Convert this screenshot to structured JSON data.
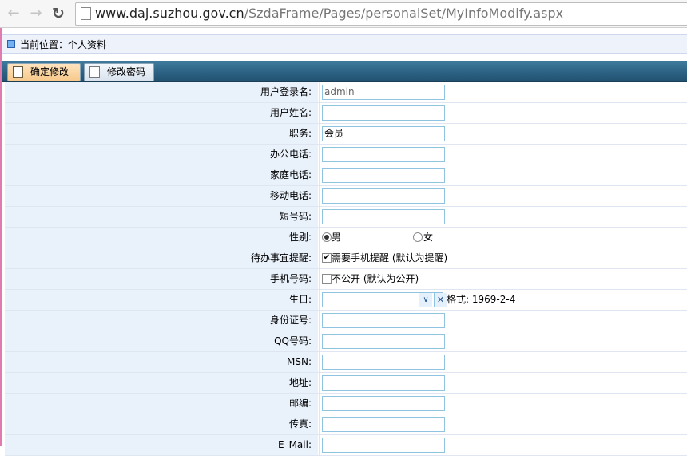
{
  "browser": {
    "url_host": "www.daj.suzhou.gov.cn",
    "url_path": "/SzdaFrame/Pages/personalSet/MyInfoModify.aspx"
  },
  "breadcrumb": "当前位置：个人资料",
  "toolbar": {
    "save_label": "确定修改",
    "password_label": "修改密码"
  },
  "fields": [
    {
      "label": "用户登录名:",
      "value": "admin"
    },
    {
      "label": "用户姓名:",
      "value": ""
    },
    {
      "label": "职务:",
      "value": "会员"
    },
    {
      "label": "办公电话:",
      "value": ""
    },
    {
      "label": "家庭电话:",
      "value": ""
    },
    {
      "label": "移动电话:",
      "value": ""
    },
    {
      "label": "短号码:",
      "value": ""
    }
  ],
  "gender": {
    "label": "性别:",
    "male": "男",
    "female": "女",
    "selected": "男"
  },
  "todo": {
    "label": "待办事宜提醒:",
    "option": "需要手机提醒 (默认为提醒)",
    "checked": true
  },
  "mobile": {
    "label": "手机号码:",
    "option": "不公开 (默认为公开)",
    "checked": false
  },
  "birthday": {
    "label": "生日:",
    "value": "",
    "hint": "格式: 1969-2-4"
  },
  "fields2": [
    {
      "label": "身份证号:",
      "value": ""
    },
    {
      "label": "QQ号码:",
      "value": ""
    },
    {
      "label": "MSN:",
      "value": ""
    },
    {
      "label": "地址:",
      "value": ""
    },
    {
      "label": "邮编:",
      "value": ""
    },
    {
      "label": "传真:",
      "value": ""
    },
    {
      "label": "E_Mail:",
      "value": ""
    }
  ],
  "colors": {
    "accent": "#2d6283",
    "label_bg": "#e9f1fb",
    "input_border": "#8fc3e0"
  }
}
